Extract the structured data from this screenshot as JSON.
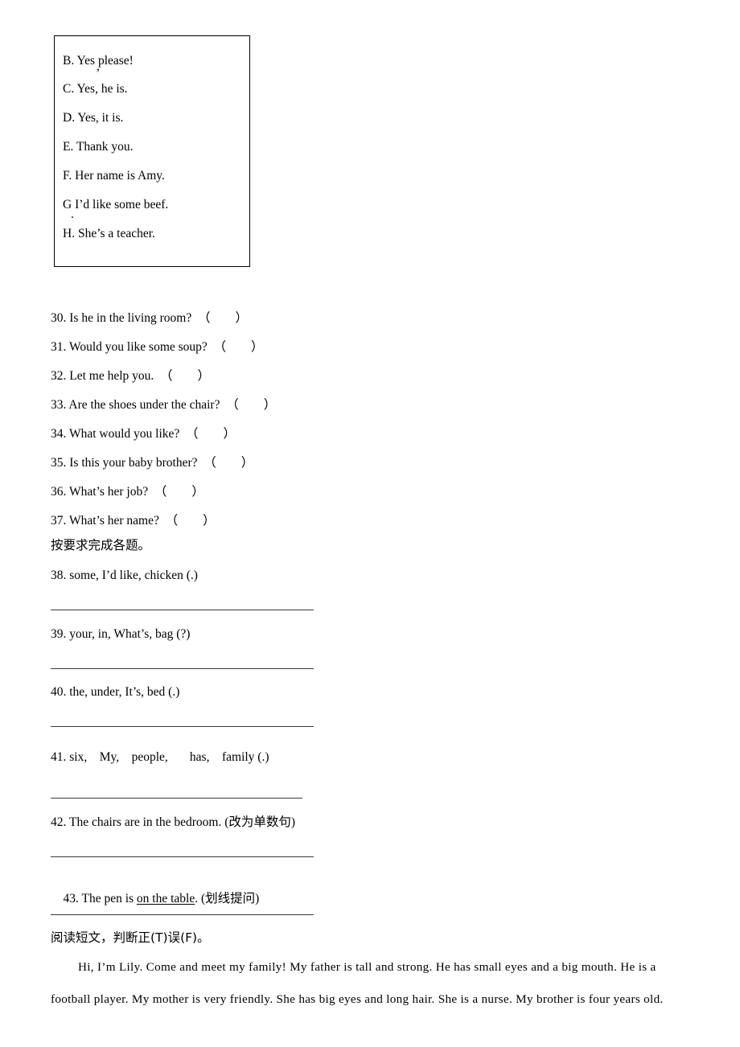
{
  "options_box": {
    "name": "answer-options-box",
    "items": [
      {
        "id": "B",
        "label": "B. Yes   please!",
        "stray_mark": ","
      },
      {
        "id": "C",
        "label": "C. Yes, he is."
      },
      {
        "id": "D",
        "label": "D. Yes, it is."
      },
      {
        "id": "E",
        "label": "E. Thank you."
      },
      {
        "id": "F",
        "label": "F. Her name is Amy."
      },
      {
        "id": "G",
        "label": "G  I’d like some beef.",
        "stray_mark": "."
      },
      {
        "id": "H",
        "label": "H. She’s a teacher."
      }
    ]
  },
  "matching_questions": [
    {
      "number": "30",
      "text": "30. Is he in the living room?  （        ）"
    },
    {
      "number": "31",
      "text": "31. Would you like some soup?  （        ）"
    },
    {
      "number": "32",
      "text": "32. Let me help you.  （        ）"
    },
    {
      "number": "33",
      "text": "33. Are the shoes under the chair?  （        ）"
    },
    {
      "number": "34",
      "text": "34. What would you like?  （        ）"
    },
    {
      "number": "35",
      "text": "35. Is this your baby brother?  （        ）"
    },
    {
      "number": "36",
      "text": "36. What’s her job?  （        ）"
    },
    {
      "number": "37",
      "text": "37. What’s her name?  （        ）"
    }
  ],
  "instruction_rearrange": "按要求完成各题。",
  "rearrange_questions": [
    {
      "number": "38",
      "text": "38. some, I’d like, chicken (.)"
    },
    {
      "number": "39",
      "text": "39. your, in, What’s, bag (?)"
    },
    {
      "number": "40",
      "text": "40. the, under, It’s, bed (.)"
    },
    {
      "number": "41",
      "text": "41. six,    My,    people,       has,    family (.)"
    },
    {
      "number": "42",
      "text": "42. The chairs are in the bedroom. (改为单数句)"
    }
  ],
  "question_43": {
    "prefix": "43. The pen is ",
    "underlined": "on the table",
    "suffix": ". (划线提问)"
  },
  "instruction_reading": "阅读短文，判断正(T)误(F)。",
  "passage": {
    "line1": "Hi, I’m Lily. Come and meet my family! My father is tall and strong. He has small eyes and a big mouth. He is a",
    "line2": "football player. My mother is very friendly. She has big eyes and long hair. She is a nurse. My brother is four years old."
  },
  "colors": {
    "text": "#000000",
    "rule": "#3a3a3a",
    "box_border": "#000000",
    "background": "#ffffff"
  }
}
